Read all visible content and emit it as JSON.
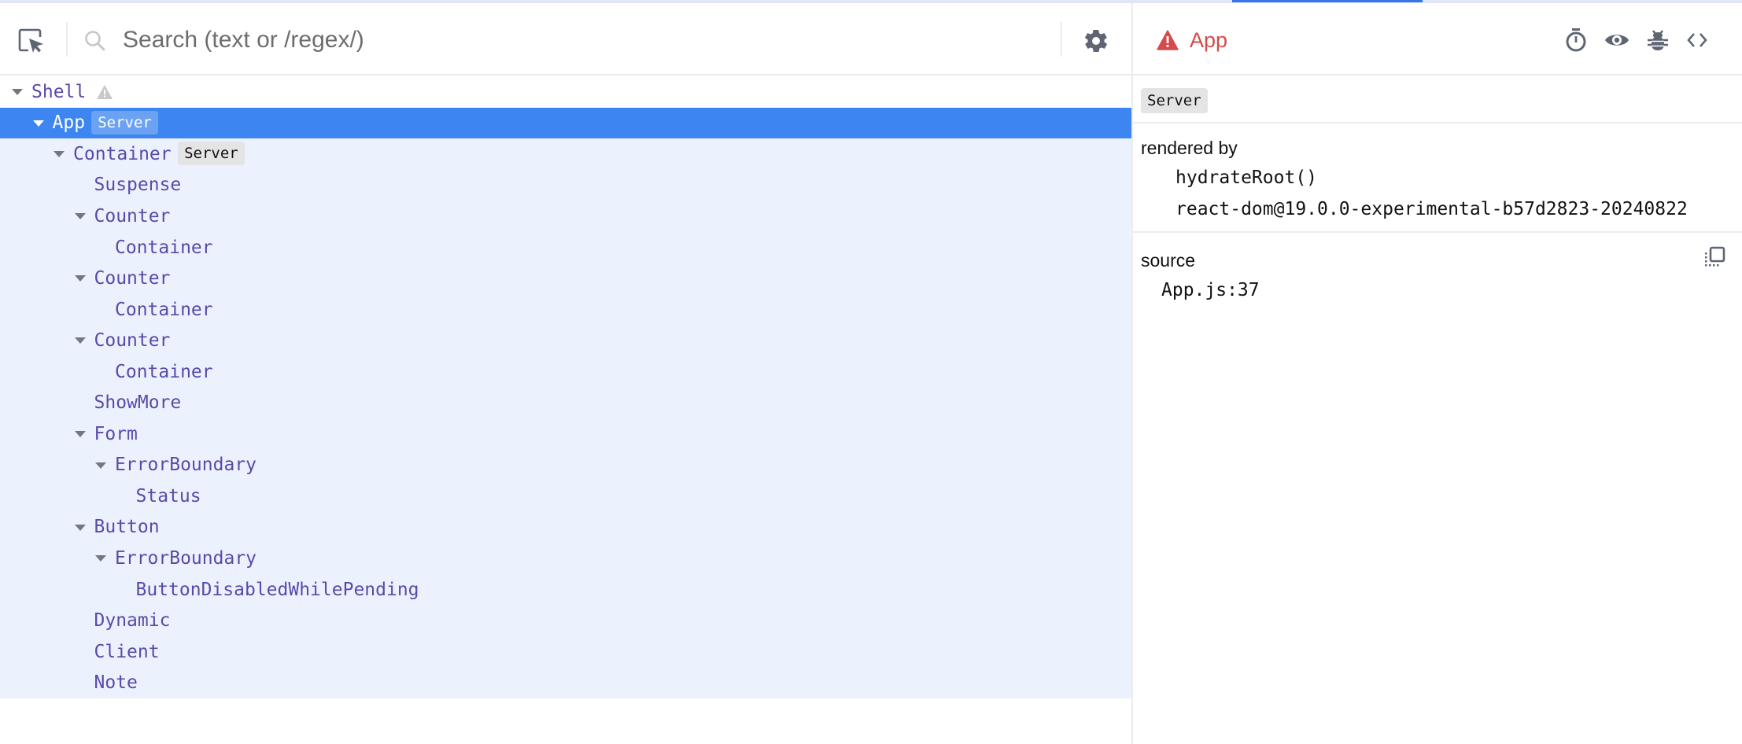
{
  "toolbar": {
    "search_placeholder": "Search (text or /regex/)",
    "search_value": ""
  },
  "tree": {
    "rows": [
      {
        "name": "Shell",
        "depth": 0,
        "expandable": true,
        "badge": null,
        "warning": true,
        "state": "normal"
      },
      {
        "name": "App",
        "depth": 1,
        "expandable": true,
        "badge": "Server",
        "warning": false,
        "state": "selected"
      },
      {
        "name": "Container",
        "depth": 2,
        "expandable": true,
        "badge": "Server",
        "warning": false,
        "state": "sub"
      },
      {
        "name": "Suspense",
        "depth": 3,
        "expandable": false,
        "badge": null,
        "warning": false,
        "state": "sub"
      },
      {
        "name": "Counter",
        "depth": 3,
        "expandable": true,
        "badge": null,
        "warning": false,
        "state": "sub"
      },
      {
        "name": "Container",
        "depth": 4,
        "expandable": false,
        "badge": null,
        "warning": false,
        "state": "sub"
      },
      {
        "name": "Counter",
        "depth": 3,
        "expandable": true,
        "badge": null,
        "warning": false,
        "state": "sub"
      },
      {
        "name": "Container",
        "depth": 4,
        "expandable": false,
        "badge": null,
        "warning": false,
        "state": "sub"
      },
      {
        "name": "Counter",
        "depth": 3,
        "expandable": true,
        "badge": null,
        "warning": false,
        "state": "sub"
      },
      {
        "name": "Container",
        "depth": 4,
        "expandable": false,
        "badge": null,
        "warning": false,
        "state": "sub"
      },
      {
        "name": "ShowMore",
        "depth": 3,
        "expandable": false,
        "badge": null,
        "warning": false,
        "state": "sub"
      },
      {
        "name": "Form",
        "depth": 3,
        "expandable": true,
        "badge": null,
        "warning": false,
        "state": "sub"
      },
      {
        "name": "ErrorBoundary",
        "depth": 4,
        "expandable": true,
        "badge": null,
        "warning": false,
        "state": "sub"
      },
      {
        "name": "Status",
        "depth": 5,
        "expandable": false,
        "badge": null,
        "warning": false,
        "state": "sub"
      },
      {
        "name": "Button",
        "depth": 3,
        "expandable": true,
        "badge": null,
        "warning": false,
        "state": "sub"
      },
      {
        "name": "ErrorBoundary",
        "depth": 4,
        "expandable": true,
        "badge": null,
        "warning": false,
        "state": "sub"
      },
      {
        "name": "ButtonDisabledWhilePending",
        "depth": 5,
        "expandable": false,
        "badge": null,
        "warning": false,
        "state": "sub"
      },
      {
        "name": "Dynamic",
        "depth": 3,
        "expandable": false,
        "badge": null,
        "warning": false,
        "state": "sub"
      },
      {
        "name": "Client",
        "depth": 3,
        "expandable": false,
        "badge": null,
        "warning": false,
        "state": "sub"
      },
      {
        "name": "Note",
        "depth": 3,
        "expandable": false,
        "badge": null,
        "warning": false,
        "state": "sub"
      }
    ]
  },
  "inspector": {
    "component_name": "App",
    "has_error": true,
    "environment_badge": "Server",
    "rendered_by": {
      "title": "rendered by",
      "items": [
        "hydrateRoot()",
        "react-dom@19.0.0-experimental-b57d2823-20240822"
      ]
    },
    "source": {
      "title": "source",
      "location": "App.js:37"
    },
    "tools": [
      "stopwatch-icon",
      "eye-icon",
      "bug-icon",
      "code-icon"
    ]
  },
  "colors": {
    "selected_row": "#3d85f0",
    "subtree_bg": "#ebf2fd",
    "component_name": "#5a4aa8",
    "error": "#d54a4a",
    "icon": "#5f6672"
  }
}
